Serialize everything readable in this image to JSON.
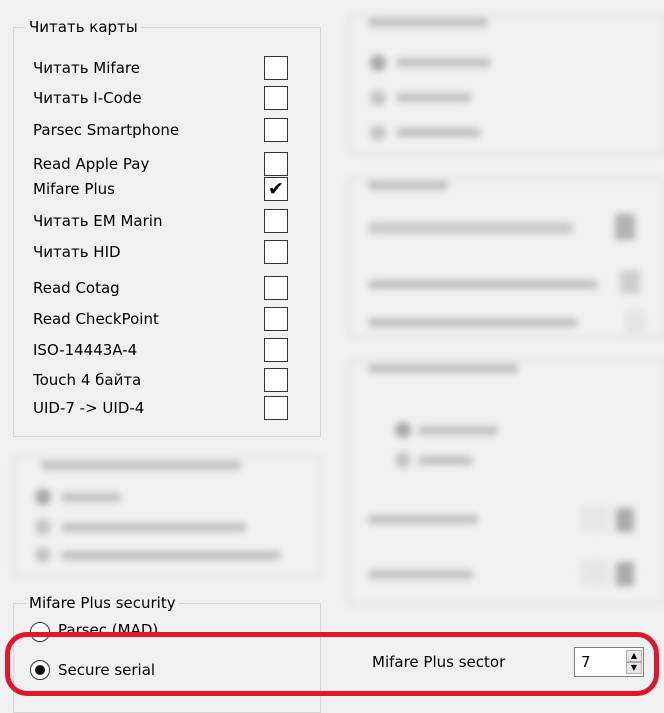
{
  "read_cards": {
    "title": "Читать карты",
    "items": [
      {
        "label": "Читать Mifare",
        "checked": false
      },
      {
        "label": "Читать I-Code",
        "checked": false
      },
      {
        "label": "Parsec Smartphone",
        "checked": false
      },
      {
        "label": "Read Apple Pay",
        "checked": false
      },
      {
        "label": "Mifare Plus",
        "checked": true
      },
      {
        "label": "Читать EM Marin",
        "checked": false
      },
      {
        "label": "Читать HID",
        "checked": false
      },
      {
        "label": "Read Cotag",
        "checked": false
      },
      {
        "label": "Read CheckPoint",
        "checked": false
      },
      {
        "label": "ISO-14443A-4",
        "checked": false
      },
      {
        "label": "Touch 4 байта",
        "checked": false
      },
      {
        "label": "UID-7 -> UID-4",
        "checked": false
      }
    ],
    "check_glyph": "✔"
  },
  "mifare_plus_security": {
    "title": "Mifare Plus security",
    "options": [
      {
        "label": "Parsec (MAD)",
        "selected": false
      },
      {
        "label": "Secure serial",
        "selected": true
      }
    ]
  },
  "mifare_plus_sector": {
    "label": "Mifare Plus sector",
    "value": "7"
  },
  "colors": {
    "highlight": "#e0162b",
    "background": "#f0f0f0"
  }
}
